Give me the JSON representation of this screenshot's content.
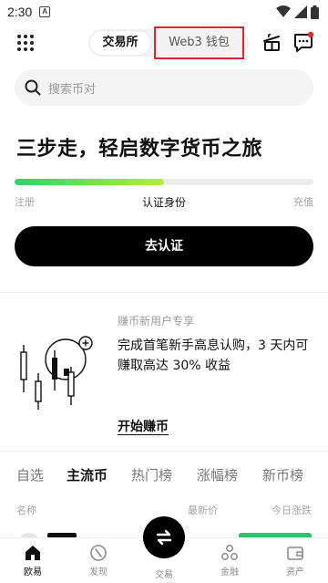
{
  "status_bar": {
    "time": "2:30",
    "notification_letter": "A"
  },
  "header": {
    "segment_exchange": "交易所",
    "segment_web3": "Web3 钱包"
  },
  "search": {
    "placeholder": "搜索币对"
  },
  "onboarding": {
    "headline": "三步走，轻启数字货币之旅",
    "progress": 0.5,
    "steps": [
      "注册",
      "认证身份",
      "充值"
    ],
    "cta_label": "去认证"
  },
  "earn": {
    "label": "赚币新用户专享",
    "description": "完成首笔新手高息认购，3 天内可赚取高达 30% 收益",
    "link": "开始赚币"
  },
  "market": {
    "tabs": [
      "自选",
      "主流币",
      "热门榜",
      "涨幅榜",
      "新币榜"
    ],
    "active_tab": "主流币",
    "columns": [
      "名称",
      "最新价",
      "今日涨跌"
    ]
  },
  "bottom_nav": {
    "items": [
      "欧易",
      "发现",
      "交易",
      "金融",
      "资产"
    ],
    "active": "欧易"
  },
  "colors": {
    "accent_green": "#2bd46a",
    "highlight_red": "#e0242b",
    "cta_black": "#000000"
  }
}
